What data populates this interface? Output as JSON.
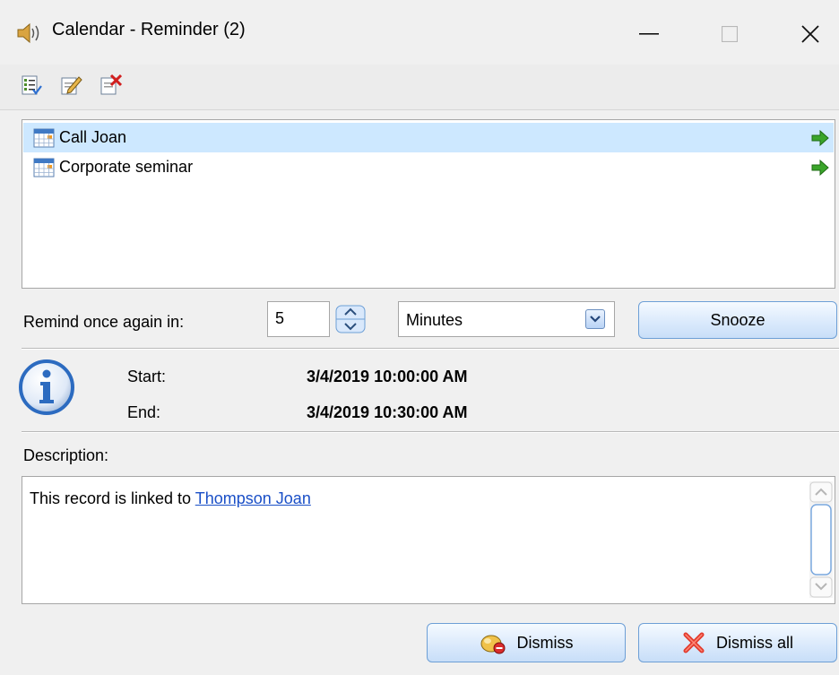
{
  "window": {
    "title": "Calendar - Reminder (2)",
    "icon": "speaker-icon",
    "controls": [
      "minimize-icon",
      "maximize-icon",
      "close-icon"
    ]
  },
  "toolbar": {
    "icons": [
      "checklist-icon",
      "edit-note-icon",
      "delete-note-icon"
    ]
  },
  "reminders": {
    "items": [
      {
        "label": "Call Joan",
        "selected": true,
        "icon": "calendar-icon",
        "action_icon": "green-arrow-icon"
      },
      {
        "label": "Corporate seminar",
        "selected": false,
        "icon": "calendar-icon",
        "action_icon": "green-arrow-icon"
      }
    ]
  },
  "snooze": {
    "label": "Remind once again in:",
    "value": "5",
    "unit": "Minutes",
    "button": "Snooze"
  },
  "details": {
    "start_label": "Start:",
    "start_value": "3/4/2019 10:00:00 AM",
    "end_label": "End:",
    "end_value": "3/4/2019 10:30:00 AM"
  },
  "description": {
    "label": "Description:",
    "text": "This record is linked to ",
    "link": "Thompson Joan"
  },
  "actions": {
    "dismiss": "Dismiss",
    "dismiss_all": "Dismiss all"
  },
  "colors": {
    "selection": "#cde8ff",
    "link": "#1a4fc7",
    "button_border": "#6d9fd6"
  }
}
